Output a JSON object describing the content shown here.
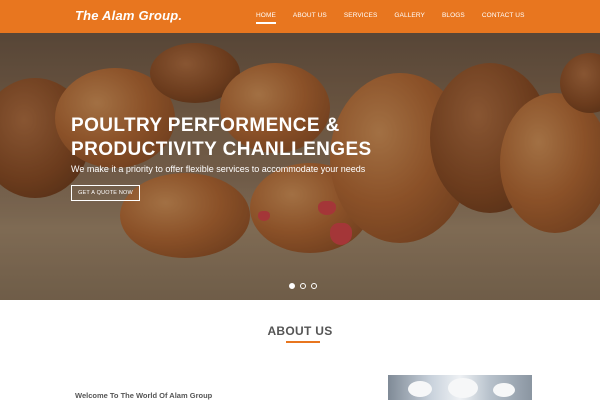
{
  "header": {
    "brand": "The Alam Group.",
    "nav": [
      {
        "label": "HOME"
      },
      {
        "label": "ABOUT US"
      },
      {
        "label": "SERVICES"
      },
      {
        "label": "GALLERY"
      },
      {
        "label": "BLOGS"
      },
      {
        "label": "CONTACT US"
      }
    ],
    "active_index": 0
  },
  "hero": {
    "title_line1": "POULTRY PERFORMENCE &",
    "title_line2": "PRODUCTIVITY CHANLLENGES",
    "subtitle": "We make it a priority to offer flexible services to accommodate your needs",
    "cta_label": "GET A QUOTE NOW",
    "slides": 3,
    "active_slide": 0
  },
  "about": {
    "title": "ABOUT US",
    "welcome": "Welcome To The World Of Alam Group"
  },
  "colors": {
    "accent": "#e8761f",
    "heading": "#555555"
  }
}
